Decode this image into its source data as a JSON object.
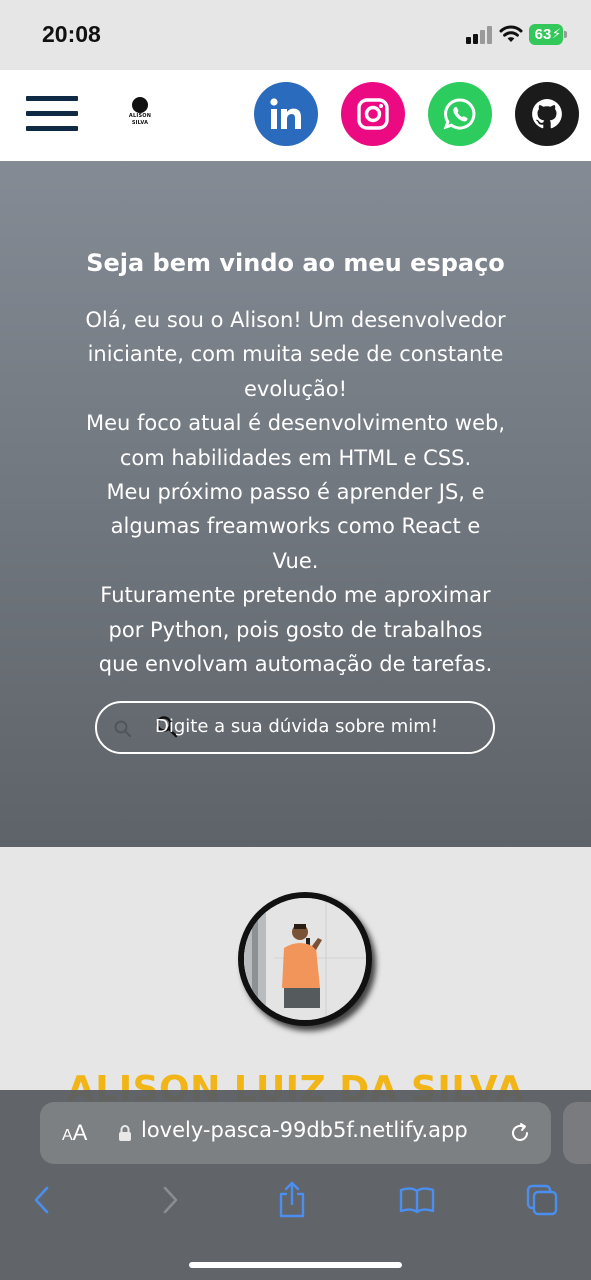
{
  "status_bar": {
    "time": "20:08",
    "battery_percent": "63",
    "icons": [
      "signal-icon",
      "wifi-icon",
      "battery-charging-icon"
    ]
  },
  "header": {
    "menu_icon": "hamburger-menu-icon",
    "logo_text": "ALISON SILVA",
    "social_links": [
      {
        "name": "LinkedIn",
        "icon": "linkedin-icon",
        "color": "#2a6bbd"
      },
      {
        "name": "Instagram",
        "icon": "instagram-icon",
        "color": "#ec0a82"
      },
      {
        "name": "WhatsApp",
        "icon": "whatsapp-icon",
        "color": "#2dcc5e"
      },
      {
        "name": "GitHub",
        "icon": "github-icon",
        "color": "#1c1b1b"
      }
    ]
  },
  "hero": {
    "title": "Seja bem vindo ao meu espaço",
    "lines": [
      "Olá, eu sou o Alison! Um desenvolvedor",
      "iniciante, com muita sede de constante",
      "evolução!",
      "Meu foco atual é desenvolvimento web,",
      "com habilidades em HTML e CSS.",
      "Meu próximo passo é aprender JS, e",
      "algumas freamworks como React e",
      "Vue.",
      "Futuramente pretendo me aproximar",
      "por Python, pois gosto de trabalhos",
      "que envolvam automação de tarefas."
    ],
    "search_placeholder": "Digite a sua dúvida sobre mim!"
  },
  "about": {
    "name": "ALISON LUIZ DA SILVA",
    "name_color": "#f2b517"
  },
  "browser": {
    "text_size_label_small": "A",
    "text_size_label_big": "A",
    "url": "lovely-pasca-99db5f.netlify.app",
    "toolbar_icons": [
      "back-icon",
      "forward-icon",
      "share-icon",
      "bookmarks-icon",
      "tabs-icon"
    ]
  }
}
